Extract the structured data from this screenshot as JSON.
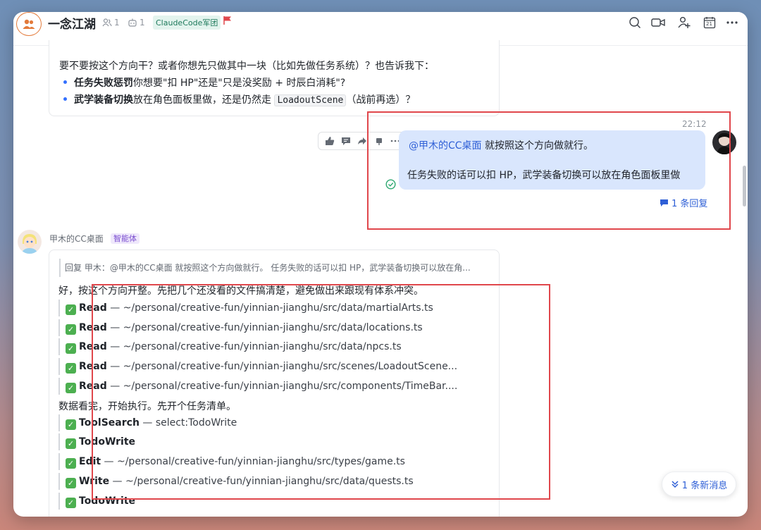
{
  "header": {
    "title": "一念江湖",
    "member_count": "1",
    "bot_count": "1",
    "tag": "ClaudeCode军团",
    "calendar_day": "21"
  },
  "prev_message": {
    "question": "要不要按这个方向干？或者你想先只做其中一块（比如先做任务系统）？也告诉我下：",
    "bullet1_bold": "任务失败惩罚",
    "bullet1_rest": "你想要\"扣 HP\"还是\"只是没奖励 + 时辰白消耗\"?",
    "bullet2_bold": "武学装备切换",
    "bullet2_mid": "放在角色面板里做，还是仍然走",
    "bullet2_code": "LoadoutScene",
    "bullet2_end": "（战前再选）？"
  },
  "user_message": {
    "time": "22:12",
    "mention": "@甲木的CC桌面",
    "line1_rest": " 就按照这个方向做就行。",
    "line2": "任务失败的话可以扣 HP，武学装备切换可以放在角色面板里做",
    "reply_count": "1 条回复"
  },
  "bot_message": {
    "sender": "甲木的CC桌面",
    "sender_badge": "智能体",
    "quote": "回复 甲木：@甲木的CC桌面 就按照这个方向做就行。 任务失败的话可以扣 HP，武学装备切换可以放在角...",
    "intro": "好，按这个方向开整。先把几个还没看的文件搞清楚，避免做出来跟现有体系冲突。",
    "reads": [
      {
        "tool": "Read",
        "path": " — ~/personal/creative-fun/yinnian-jianghu/src/data/martialArts.ts"
      },
      {
        "tool": "Read",
        "path": " — ~/personal/creative-fun/yinnian-jianghu/src/data/locations.ts"
      },
      {
        "tool": "Read",
        "path": " — ~/personal/creative-fun/yinnian-jianghu/src/data/npcs.ts"
      },
      {
        "tool": "Read",
        "path": " — ~/personal/creative-fun/yinnian-jianghu/src/scenes/LoadoutScene..."
      },
      {
        "tool": "Read",
        "path": " — ~/personal/creative-fun/yinnian-jianghu/src/components/TimeBar...."
      }
    ],
    "middle": "数据看完，开始执行。先开个任务清单。",
    "actions": [
      {
        "tool": "ToolSearch",
        "path": " — select:TodoWrite"
      },
      {
        "tool": "TodoWrite",
        "path": ""
      },
      {
        "tool": "Edit",
        "path": " — ~/personal/creative-fun/yinnian-jianghu/src/types/game.ts"
      },
      {
        "tool": "Write",
        "path": " — ~/personal/creative-fun/yinnian-jianghu/src/data/quests.ts"
      },
      {
        "tool": "TodoWrite",
        "path": ""
      }
    ]
  },
  "new_messages": "1 条新消息",
  "colors": {
    "accent": "#3370ff",
    "highlight_box": "#e0474c",
    "bubble": "#d9e6fd"
  }
}
